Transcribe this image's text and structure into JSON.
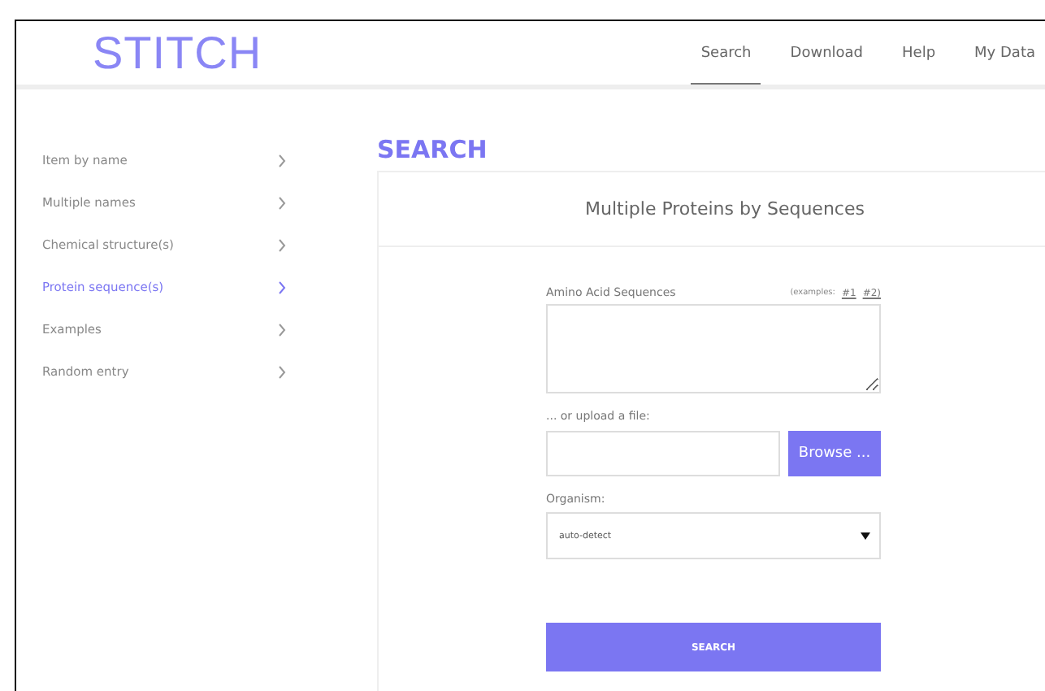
{
  "logo": "STITCH",
  "nav": [
    {
      "label": "Search",
      "selected": true
    },
    {
      "label": "Download",
      "selected": false
    },
    {
      "label": "Help",
      "selected": false
    },
    {
      "label": "My Data",
      "selected": false
    }
  ],
  "sidebar": {
    "items": [
      {
        "label": "Item by name",
        "selected": false
      },
      {
        "label": "Multiple names",
        "selected": false
      },
      {
        "label": "Chemical structure(s)",
        "selected": false
      },
      {
        "label": "Protein sequence(s)",
        "selected": true
      },
      {
        "label": "Examples",
        "selected": false
      },
      {
        "label": "Random entry",
        "selected": false
      }
    ]
  },
  "heading": "SEARCH",
  "card": {
    "title": "Multiple Proteins by Sequences",
    "sequences_label": "Amino Acid Sequences",
    "examples_label": "(examples:",
    "example_links": [
      "#1",
      "#2)"
    ],
    "upload_label": "... or upload a file:",
    "browse_button": "Browse ...",
    "organism_label": "Organism:",
    "organism_value": "auto-detect",
    "search_button": "SEARCH"
  }
}
